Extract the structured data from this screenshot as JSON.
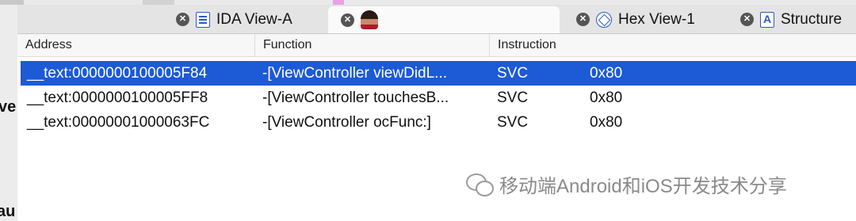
{
  "colors": {
    "selection": "#1c5ad6",
    "tab_bar": "#e4e4e4",
    "icon_accent": "#2f58c8"
  },
  "left_pane": {
    "fragments": [
      "ve",
      "au"
    ]
  },
  "tabs": [
    {
      "label": "IDA View-A",
      "icon": "ida-view-icon",
      "active": false
    },
    {
      "label": "",
      "icon": "avatar-icon",
      "active": true
    },
    {
      "label": "Hex View-1",
      "icon": "hex-view-icon",
      "active": false
    },
    {
      "label": "Structure",
      "icon": "structures-icon",
      "active": false
    }
  ],
  "table": {
    "columns": [
      "Address",
      "Function",
      "Instruction"
    ],
    "rows": [
      {
        "address": "__text:0000000100005F84",
        "function": "-[ViewController viewDidL...",
        "instruction": "SVC",
        "operand": "0x80",
        "selected": true
      },
      {
        "address": "__text:0000000100005FF8",
        "function": "-[ViewController touchesB...",
        "instruction": "SVC",
        "operand": "0x80",
        "selected": false
      },
      {
        "address": "__text:00000001000063FC",
        "function": "-[ViewController ocFunc:]",
        "instruction": "SVC",
        "operand": "0x80",
        "selected": false
      }
    ]
  },
  "watermark": {
    "text": "移动端Android和iOS开发技术分享",
    "icon": "wechat-icon"
  }
}
